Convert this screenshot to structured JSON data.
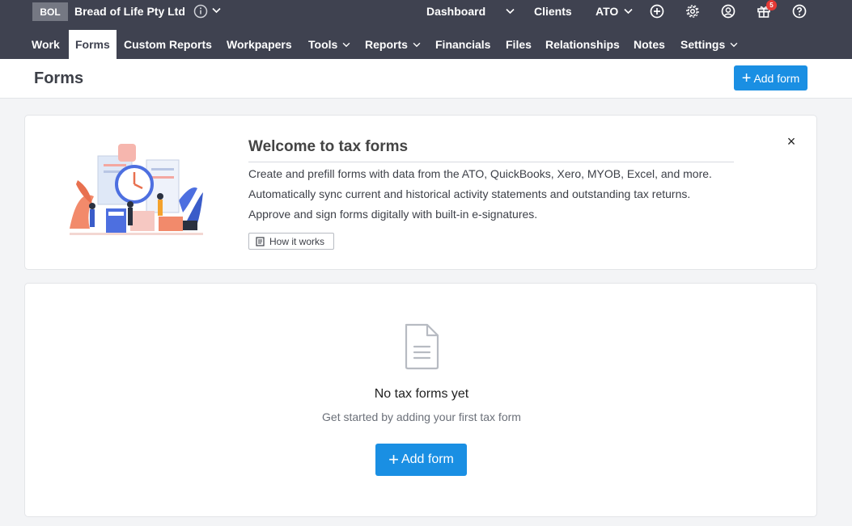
{
  "client": {
    "badge": "BOL",
    "name": "Bread of Life Pty Ltd"
  },
  "topnav": {
    "dashboard": "Dashboard",
    "clients": "Clients",
    "ato": "ATO",
    "gift_count": "5"
  },
  "nav": {
    "items": [
      {
        "label": "Work"
      },
      {
        "label": "Forms"
      },
      {
        "label": "Custom Reports"
      },
      {
        "label": "Workpapers"
      },
      {
        "label": "Tools"
      },
      {
        "label": "Reports"
      },
      {
        "label": "Financials"
      },
      {
        "label": "Files"
      },
      {
        "label": "Relationships"
      },
      {
        "label": "Notes"
      },
      {
        "label": "Settings"
      }
    ],
    "active": "Forms"
  },
  "page": {
    "title": "Forms",
    "add_button": "Add form"
  },
  "welcome": {
    "title": "Welcome to tax forms",
    "lines": [
      "Create and prefill forms with data from the ATO, QuickBooks, Xero, MYOB, Excel, and more.",
      "Automatically sync current and historical activity statements and outstanding tax returns.",
      "Approve and sign forms digitally with built-in e-signatures."
    ],
    "how_button": "How it works",
    "close": "×"
  },
  "empty": {
    "title": "No tax forms yet",
    "subtitle": "Get started by adding your first tax form",
    "add_button": "Add form"
  },
  "colors": {
    "topbar": "#3f4250",
    "accent": "#1a8fe3",
    "badge": "#e53935"
  },
  "icons": [
    "info-icon",
    "chevron-down-icon",
    "plus-circle-icon",
    "gear-icon",
    "user-circle-icon",
    "gift-icon",
    "help-icon",
    "document-icon",
    "book-icon",
    "close-icon"
  ]
}
